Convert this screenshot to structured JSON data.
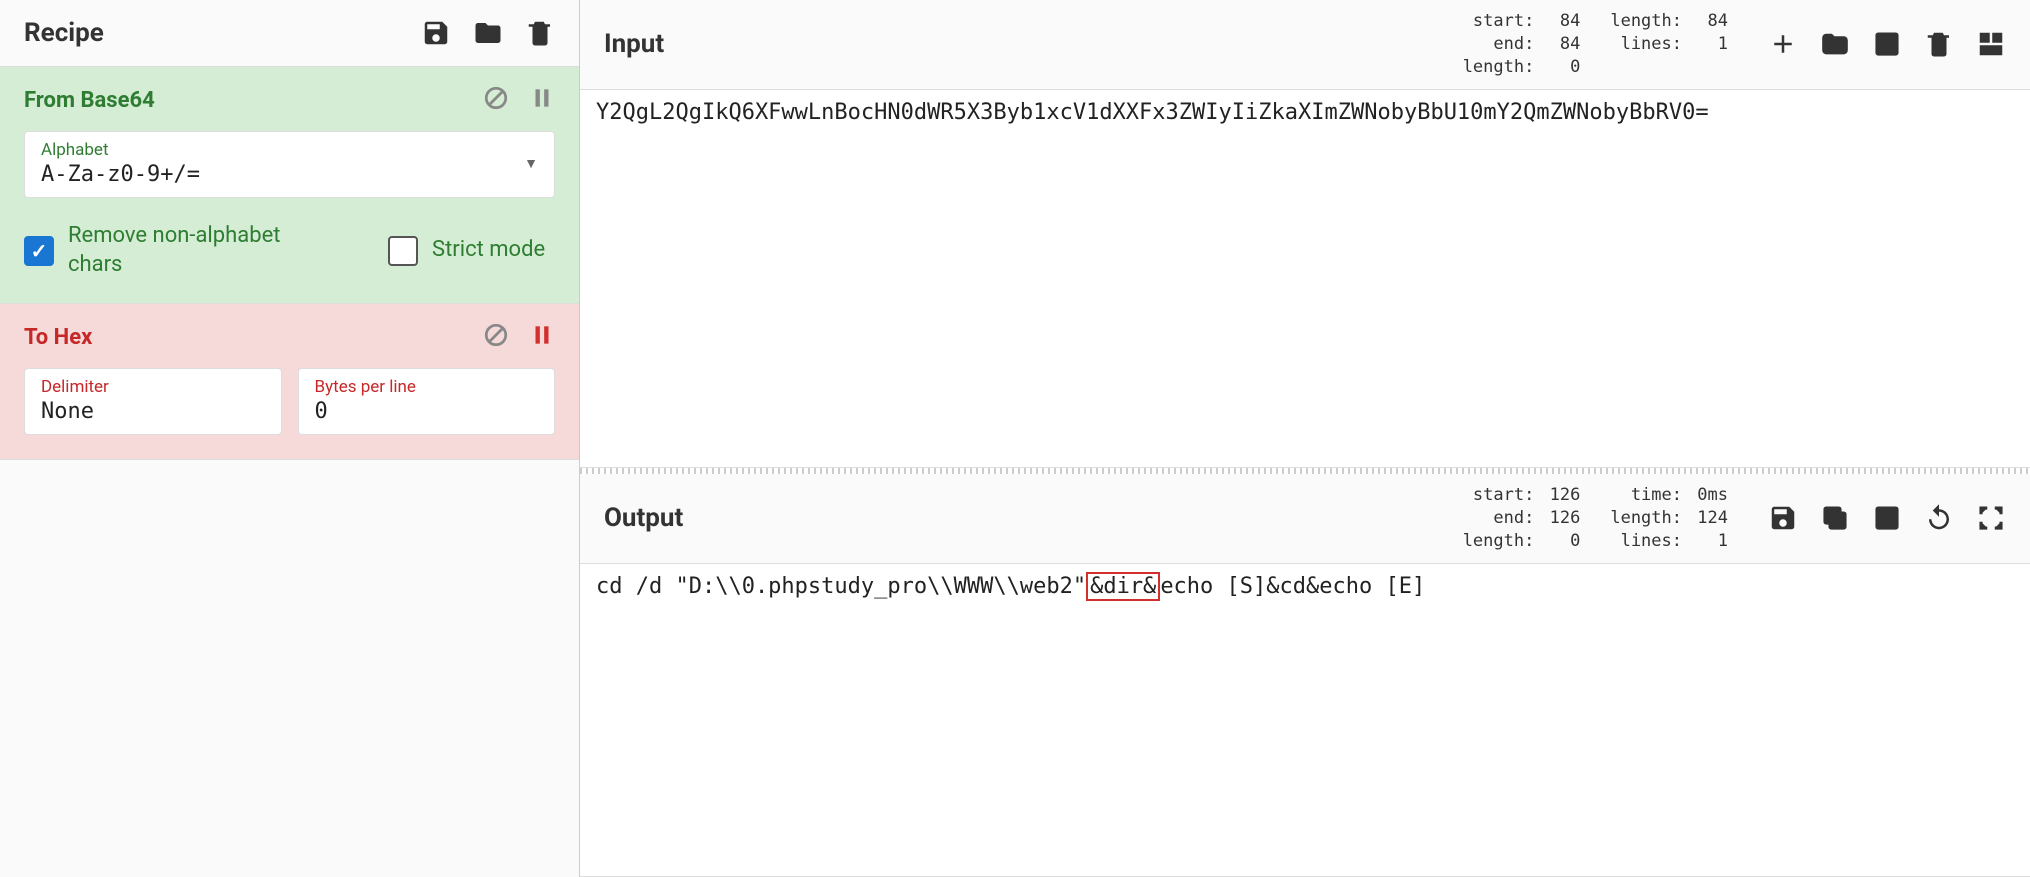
{
  "recipe": {
    "title": "Recipe",
    "ops": [
      {
        "name": "From Base64",
        "alphabet_label": "Alphabet",
        "alphabet_value": "A-Za-z0-9+/=",
        "remove_label": "Remove non-alphabet chars",
        "strict_label": "Strict mode",
        "remove_checked": true,
        "strict_checked": false,
        "paused": false
      },
      {
        "name": "To Hex",
        "delimiter_label": "Delimiter",
        "delimiter_value": "None",
        "bpl_label": "Bytes per line",
        "bpl_value": "0",
        "paused": true
      }
    ]
  },
  "input": {
    "title": "Input",
    "stats_left": {
      "start": "84",
      "end": "84",
      "length": "0"
    },
    "stats_right": {
      "length": "84",
      "lines": "1"
    },
    "text": "Y2QgL2QgIkQ6XFwwLnBocHN0dWR5X3Byb1xcV1dXXFx3ZWIyIiZkaXImZWNobyBbU10mY2QmZWNobyBbRV0="
  },
  "output": {
    "title": "Output",
    "stats_left": {
      "start": "126",
      "end": "126",
      "length": "0"
    },
    "stats_right": {
      "time": "0ms",
      "length": "124",
      "lines": "1"
    },
    "text_pre": "cd /d \"D:\\\\0.phpstudy_pro\\\\WWW\\\\web2\"",
    "text_hl": "&dir&",
    "text_post": "echo [S]&cd&echo [E]"
  },
  "labels": {
    "start": "start:",
    "end": "end:",
    "length": "length:",
    "lines": "lines:",
    "time": "time:"
  }
}
